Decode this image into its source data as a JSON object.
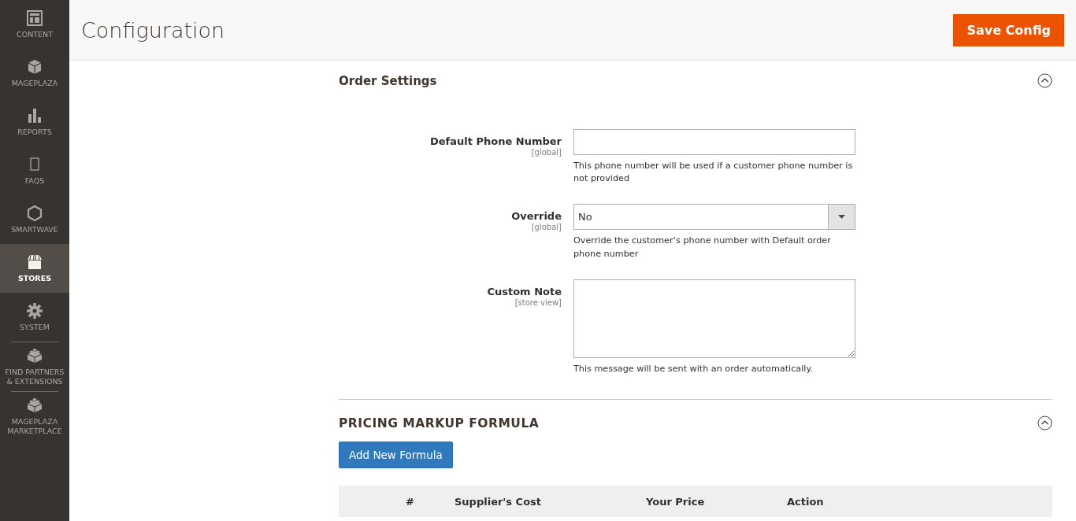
{
  "sidebar": {
    "items": [
      {
        "label": "CONTENT",
        "selected": false
      },
      {
        "label": "MAGEPLAZA",
        "selected": false
      },
      {
        "label": "REPORTS",
        "selected": false
      },
      {
        "label": "FAQS",
        "selected": false
      },
      {
        "label": "SMARTWAVE",
        "selected": false
      },
      {
        "label": "STORES",
        "selected": true
      },
      {
        "label": "SYSTEM",
        "selected": false
      },
      {
        "label": "FIND PARTNERS & EXTENSIONS",
        "selected": false
      },
      {
        "label": "MAGEPLAZA MARKETPLACE",
        "selected": false
      }
    ]
  },
  "header": {
    "title": "Configuration",
    "save_button": "Save Config"
  },
  "order_settings": {
    "title": "Order Settings",
    "fields": [
      {
        "kind": "text",
        "label": "Default Phone Number",
        "scope": "[global]",
        "note": "This phone number will be used if a customer phone number is not provided"
      },
      {
        "kind": "select",
        "label": "Override",
        "scope": "[global]",
        "value": "No",
        "note": "Override the customer’s phone number with Default order phone number"
      },
      {
        "kind": "textarea",
        "label": "Custom Note",
        "scope": "[store view]",
        "note": "This message will be sent with an order automatically."
      }
    ]
  },
  "pricing_markup": {
    "title": "PRICING MARKUP FORMULA",
    "add_button": "Add New Formula",
    "table": {
      "columns": [
        "#",
        "Supplier's Cost",
        "Your Price",
        "Action"
      ]
    }
  }
}
